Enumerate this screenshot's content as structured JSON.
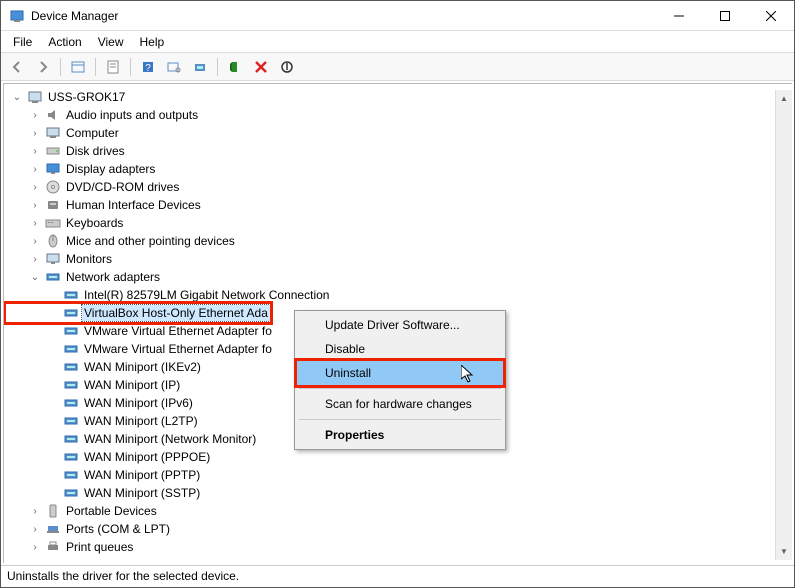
{
  "title": "Device Manager",
  "menu": [
    "File",
    "Action",
    "View",
    "Help"
  ],
  "computer_name": "USS-GROK17",
  "categories": [
    {
      "name": "Audio inputs and outputs",
      "icon": "audio"
    },
    {
      "name": "Computer",
      "icon": "computer"
    },
    {
      "name": "Disk drives",
      "icon": "disk"
    },
    {
      "name": "Display adapters",
      "icon": "display"
    },
    {
      "name": "DVD/CD-ROM drives",
      "icon": "dvd"
    },
    {
      "name": "Human Interface Devices",
      "icon": "hid"
    },
    {
      "name": "Keyboards",
      "icon": "keyboard"
    },
    {
      "name": "Mice and other pointing devices",
      "icon": "mouse"
    },
    {
      "name": "Monitors",
      "icon": "monitor"
    },
    {
      "name": "Network adapters",
      "icon": "network",
      "expanded": true,
      "children": [
        {
          "name": "Intel(R) 82579LM Gigabit Network Connection"
        },
        {
          "name": "VirtualBox Host-Only Ethernet Ada",
          "selected": true,
          "highlighted": true,
          "truncated": true
        },
        {
          "name": "VMware Virtual Ethernet Adapter fo",
          "truncated": true
        },
        {
          "name": "VMware Virtual Ethernet Adapter fo",
          "truncated": true
        },
        {
          "name": "WAN Miniport (IKEv2)"
        },
        {
          "name": "WAN Miniport (IP)"
        },
        {
          "name": "WAN Miniport (IPv6)"
        },
        {
          "name": "WAN Miniport (L2TP)"
        },
        {
          "name": "WAN Miniport (Network Monitor)"
        },
        {
          "name": "WAN Miniport (PPPOE)"
        },
        {
          "name": "WAN Miniport (PPTP)"
        },
        {
          "name": "WAN Miniport (SSTP)"
        }
      ]
    },
    {
      "name": "Portable Devices",
      "icon": "portable"
    },
    {
      "name": "Ports (COM & LPT)",
      "icon": "ports"
    },
    {
      "name": "Print queues",
      "icon": "print",
      "cutoff": true
    }
  ],
  "context_menu": [
    {
      "label": "Update Driver Software..."
    },
    {
      "label": "Disable"
    },
    {
      "label": "Uninstall",
      "hover": true,
      "highlighted": true
    },
    {
      "sep": true
    },
    {
      "label": "Scan for hardware changes"
    },
    {
      "sep": true
    },
    {
      "label": "Properties",
      "bold": true
    }
  ],
  "status_text": "Uninstalls the driver for the selected device."
}
